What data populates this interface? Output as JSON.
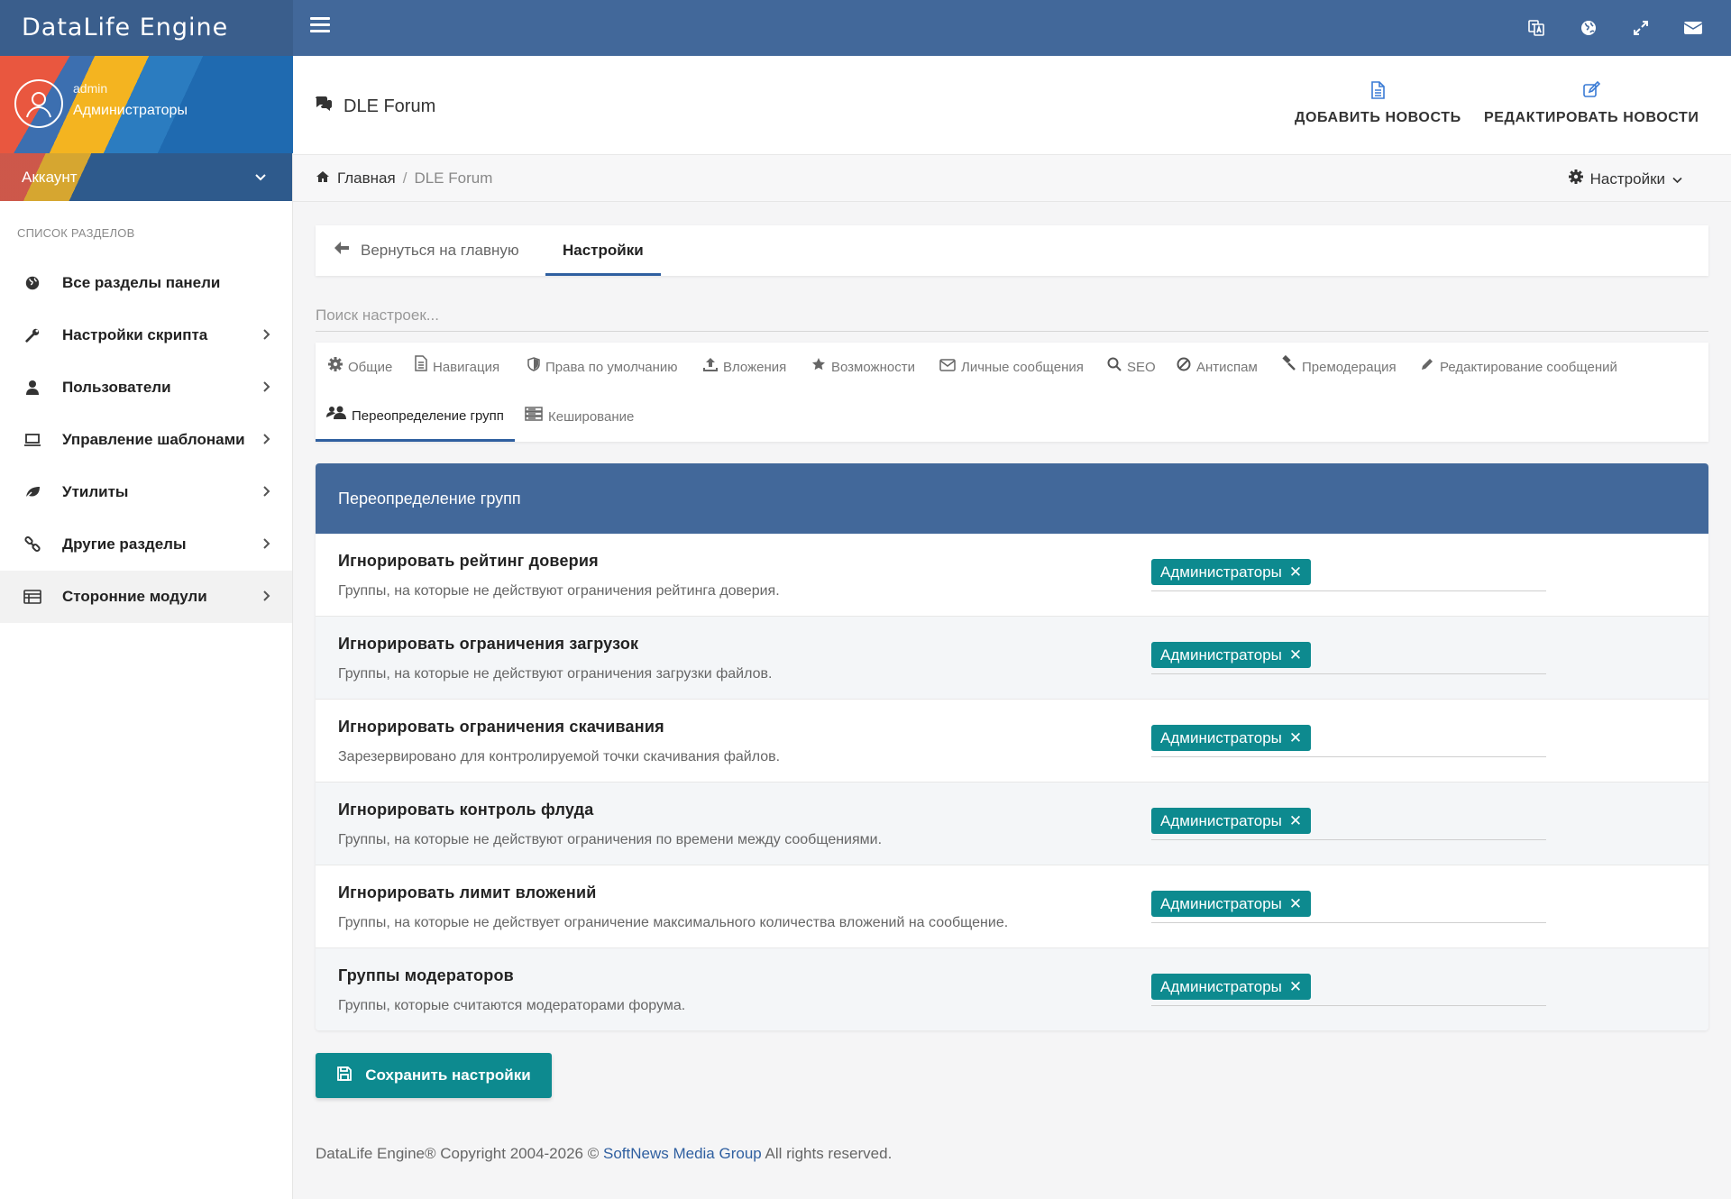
{
  "app": {
    "brand": "DataLife Engine"
  },
  "topbar": {
    "icons": [
      "translate-icon",
      "globe-icon",
      "expand-icon",
      "envelope-icon"
    ]
  },
  "user": {
    "name": "admin",
    "role": "Администраторы",
    "account_label": "Аккаунт"
  },
  "sidebar": {
    "section_title": "СПИСОК РАЗДЕЛОВ",
    "items": [
      {
        "label": "Все разделы панели",
        "icon": "globe-icon",
        "has_arrow": false
      },
      {
        "label": "Настройки скрипта",
        "icon": "wrench-icon",
        "has_arrow": true
      },
      {
        "label": "Пользователи",
        "icon": "user-icon",
        "has_arrow": true
      },
      {
        "label": "Управление шаблонами",
        "icon": "laptop-icon",
        "has_arrow": true
      },
      {
        "label": "Утилиты",
        "icon": "leaf-icon",
        "has_arrow": true
      },
      {
        "label": "Другие разделы",
        "icon": "link-icon",
        "has_arrow": true
      },
      {
        "label": "Сторонние модули",
        "icon": "list-icon",
        "has_arrow": true,
        "active": true
      }
    ]
  },
  "header": {
    "title": "DLE Forum",
    "add_news": "ДОБАВИТЬ НОВОСТЬ",
    "edit_news": "РЕДАКТИРОВАТЬ НОВОСТИ"
  },
  "breadcrumb": {
    "home": "Главная",
    "separator": "/",
    "current": "DLE Forum",
    "settings_dropdown": "Настройки"
  },
  "tabs": {
    "back": "Вернуться на главную",
    "active": "Настройки"
  },
  "search": {
    "placeholder": "Поиск настроек...",
    "value": ""
  },
  "subtabs": [
    {
      "label": "Общие",
      "icon": "gear-icon"
    },
    {
      "label": "Навигация",
      "icon": "file-icon"
    },
    {
      "label": "Права по умолчанию",
      "icon": "shield-icon"
    },
    {
      "label": "Вложения",
      "icon": "upload-icon"
    },
    {
      "label": "Возможности",
      "icon": "star-icon"
    },
    {
      "label": "Личные сообщения",
      "icon": "envelope-icon"
    },
    {
      "label": "SEO",
      "icon": "search-icon"
    },
    {
      "label": "Антиспам",
      "icon": "ban-icon"
    },
    {
      "label": "Премодерация",
      "icon": "gavel-icon"
    },
    {
      "label": "Редактирование сообщений",
      "icon": "pencil-icon"
    },
    {
      "label": "Переопределение групп",
      "icon": "users-icon",
      "active": true
    },
    {
      "label": "Кеширование",
      "icon": "cache-icon"
    }
  ],
  "panel": {
    "title": "Переопределение групп",
    "rows": [
      {
        "title": "Игнорировать рейтинг доверия",
        "desc": "Группы, на которые не действуют ограничения рейтинга доверия.",
        "tag": "Администраторы"
      },
      {
        "title": "Игнорировать ограничения загрузок",
        "desc": "Группы, на которые не действуют ограничения загрузки файлов.",
        "tag": "Администраторы"
      },
      {
        "title": "Игнорировать ограничения скачивания",
        "desc": "Зарезервировано для контролируемой точки скачивания файлов.",
        "tag": "Администраторы"
      },
      {
        "title": "Игнорировать контроль флуда",
        "desc": "Группы, на которые не действуют ограничения по времени между сообщениями.",
        "tag": "Администраторы"
      },
      {
        "title": "Игнорировать лимит вложений",
        "desc": "Группы, на которые не действует ограничение максимального количества вложений на сообщение.",
        "tag": "Администраторы"
      },
      {
        "title": "Группы модераторов",
        "desc": "Группы, которые считаются модераторами форума.",
        "tag": "Администраторы"
      }
    ]
  },
  "save_button": "Сохранить настройки",
  "footer": {
    "prefix": "DataLife Engine® Copyright 2004-2026 © ",
    "link": "SoftNews Media Group",
    "suffix": " All rights reserved."
  },
  "colors": {
    "topbar": "#42689a",
    "accent": "#0d8a8f",
    "active_tab": "#2f5fa0"
  }
}
